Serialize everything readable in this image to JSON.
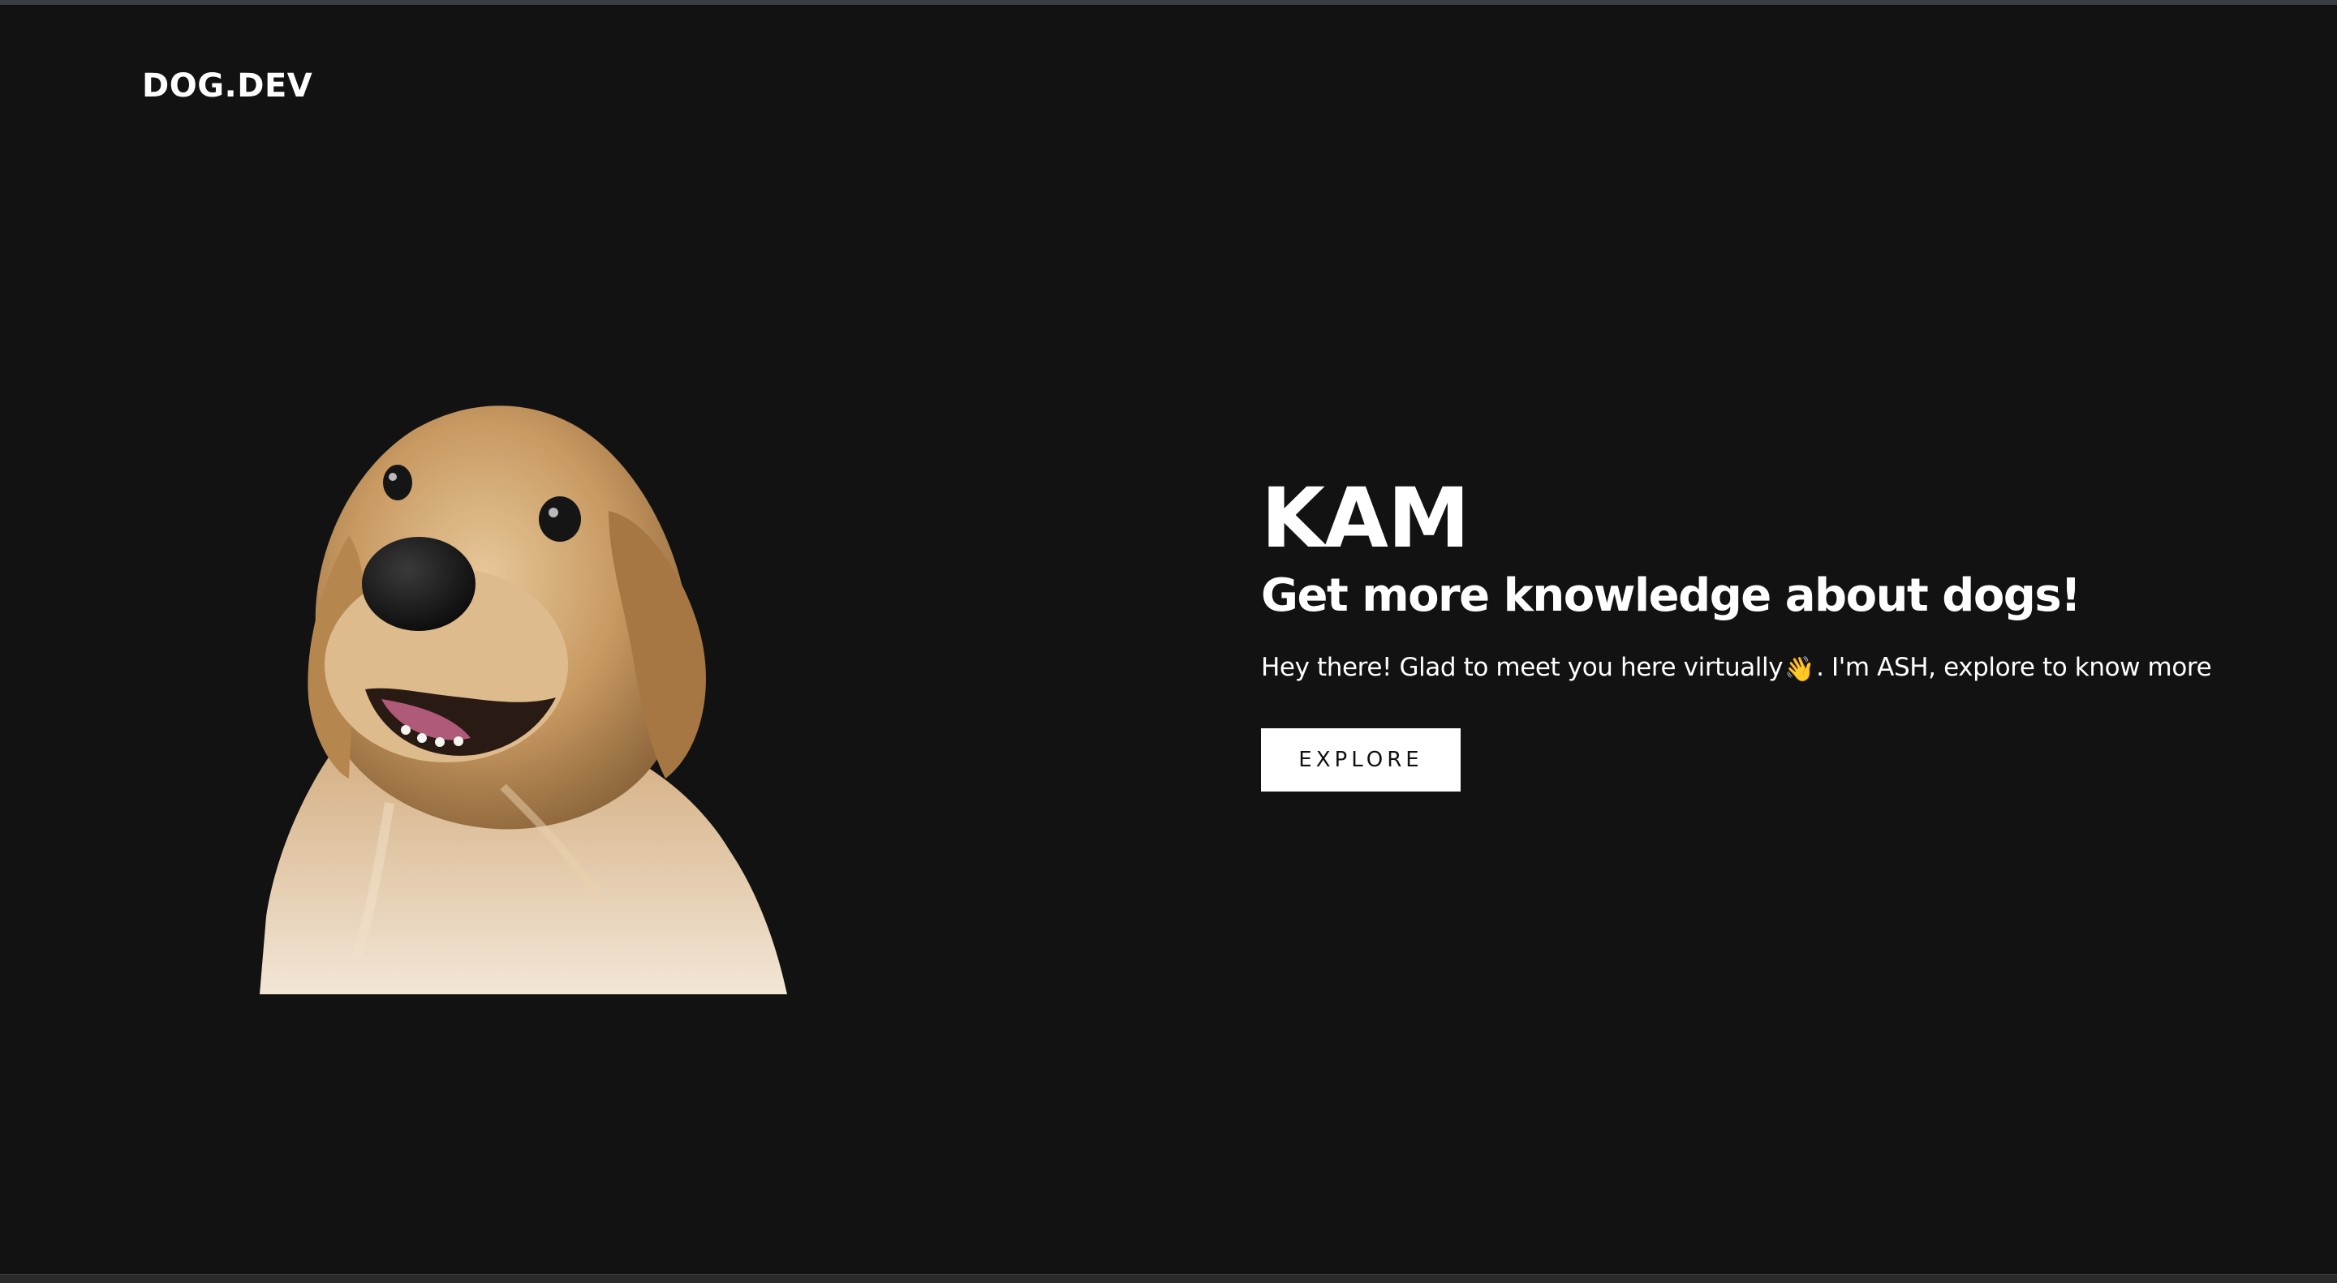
{
  "nav": {
    "logo_text": "DOG.DEV"
  },
  "hero": {
    "title": "KAM",
    "subtitle": "Get more knowledge about dogs!",
    "text_before_icon": "Hey there! Glad to meet you here virtually",
    "wave_emoji": "👋",
    "text_after_icon": ". I'm ASH, explore to know more",
    "button_label": "EXPLORE"
  },
  "image": {
    "subject": "golden-retriever-photo",
    "colors": {
      "fur": "#c99a62",
      "fur_light": "#e3c396",
      "nose": "#141414",
      "tongue": "#b05a7a"
    }
  },
  "colors": {
    "background": "#121212",
    "text": "#ffffff",
    "button_bg": "#ffffff",
    "button_text": "#111111"
  }
}
